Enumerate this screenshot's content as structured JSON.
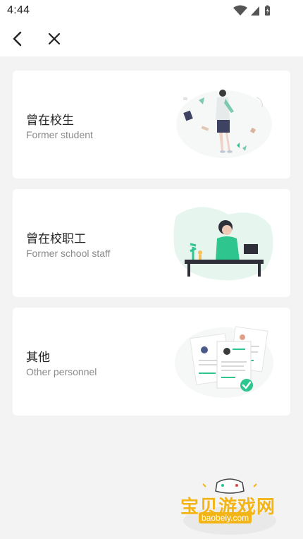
{
  "status_bar": {
    "time": "4:44"
  },
  "nav": {
    "back_icon": "chevron-left-icon",
    "close_icon": "close-icon"
  },
  "cards": [
    {
      "title": "曾在校生",
      "subtitle": "Former student",
      "illustration": "student-illustration"
    },
    {
      "title": "曾在校职工",
      "subtitle": "Former school staff",
      "illustration": "staff-illustration"
    },
    {
      "title": "其他",
      "subtitle": "Other personnel",
      "illustration": "documents-illustration"
    }
  ],
  "watermark": {
    "cn_text": "宝贝游戏网",
    "url": "baobeiy.com"
  },
  "colors": {
    "accent": "#2ec58f",
    "background": "#f3f3f4",
    "card": "#ffffff",
    "watermark": "#f3b418"
  }
}
